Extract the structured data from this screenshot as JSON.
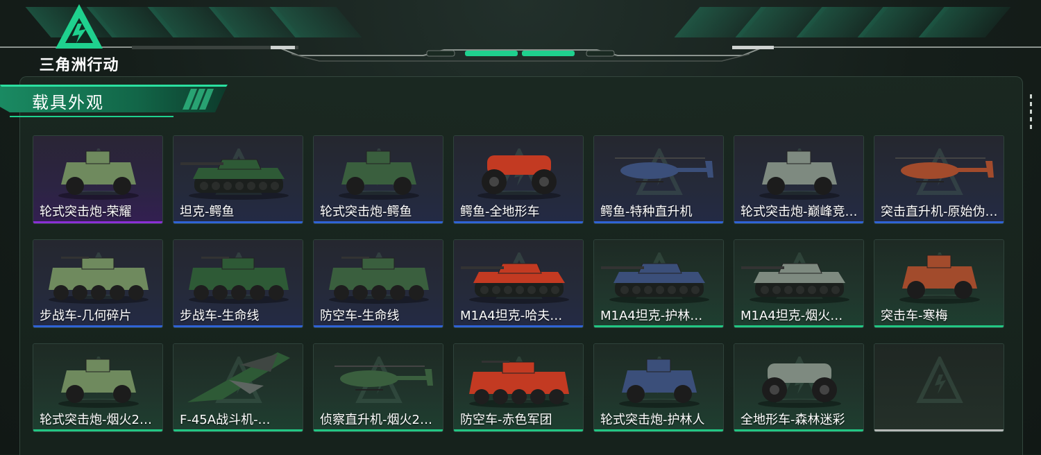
{
  "brand": {
    "logo_text": "三角洲行动"
  },
  "section": {
    "title": "载具外观"
  },
  "colors": {
    "rarity_purple": "#8a2fd6",
    "rarity_blue": "#2f63d6",
    "rarity_green": "#22c784",
    "rarity_gray": "#b5b9b7",
    "accent": "#1fd18e"
  },
  "items": [
    {
      "name": "轮式突击炮-荣耀",
      "rarity": "purple",
      "icon": "wheeled-assault-gun-icon"
    },
    {
      "name": "坦克-鳄鱼",
      "rarity": "blue",
      "icon": "tank-icon"
    },
    {
      "name": "轮式突击炮-鳄鱼",
      "rarity": "blue",
      "icon": "wheeled-assault-gun-icon"
    },
    {
      "name": "鳄鱼-全地形车",
      "rarity": "blue",
      "icon": "atv-icon"
    },
    {
      "name": "鳄鱼-特种直升机",
      "rarity": "blue",
      "icon": "helicopter-icon"
    },
    {
      "name": "轮式突击炮-巅峰竞…",
      "rarity": "blue",
      "icon": "wheeled-assault-gun-icon"
    },
    {
      "name": "突击直升机-原始伪…",
      "rarity": "blue",
      "icon": "helicopter-icon"
    },
    {
      "name": "步战车-几何碎片",
      "rarity": "blue",
      "icon": "ifv-icon"
    },
    {
      "name": "步战车-生命线",
      "rarity": "blue",
      "icon": "ifv-icon"
    },
    {
      "name": "防空车-生命线",
      "rarity": "blue",
      "icon": "ifv-icon"
    },
    {
      "name": "M1A4坦克-哈夫…",
      "rarity": "blue",
      "icon": "tank-icon"
    },
    {
      "name": "M1A4坦克-护林…",
      "rarity": "green",
      "icon": "tank-icon"
    },
    {
      "name": "M1A4坦克-烟火…",
      "rarity": "green",
      "icon": "tank-icon"
    },
    {
      "name": "突击车-寒梅",
      "rarity": "green",
      "icon": "assault-vehicle-icon"
    },
    {
      "name": "轮式突击炮-烟火2…",
      "rarity": "green",
      "icon": "wheeled-assault-gun-icon"
    },
    {
      "name": "F-45A战斗机-…",
      "rarity": "green",
      "icon": "fighter-jet-icon"
    },
    {
      "name": "侦察直升机-烟火2…",
      "rarity": "green",
      "icon": "helicopter-icon"
    },
    {
      "name": "防空车-赤色军团",
      "rarity": "green",
      "icon": "ifv-icon"
    },
    {
      "name": "轮式突击炮-护林人",
      "rarity": "green",
      "icon": "wheeled-assault-gun-icon"
    },
    {
      "name": "全地形车-森林迷彩",
      "rarity": "green",
      "icon": "atv-icon"
    },
    {
      "name": "",
      "rarity": "gray",
      "icon": "empty-slot-icon"
    }
  ]
}
